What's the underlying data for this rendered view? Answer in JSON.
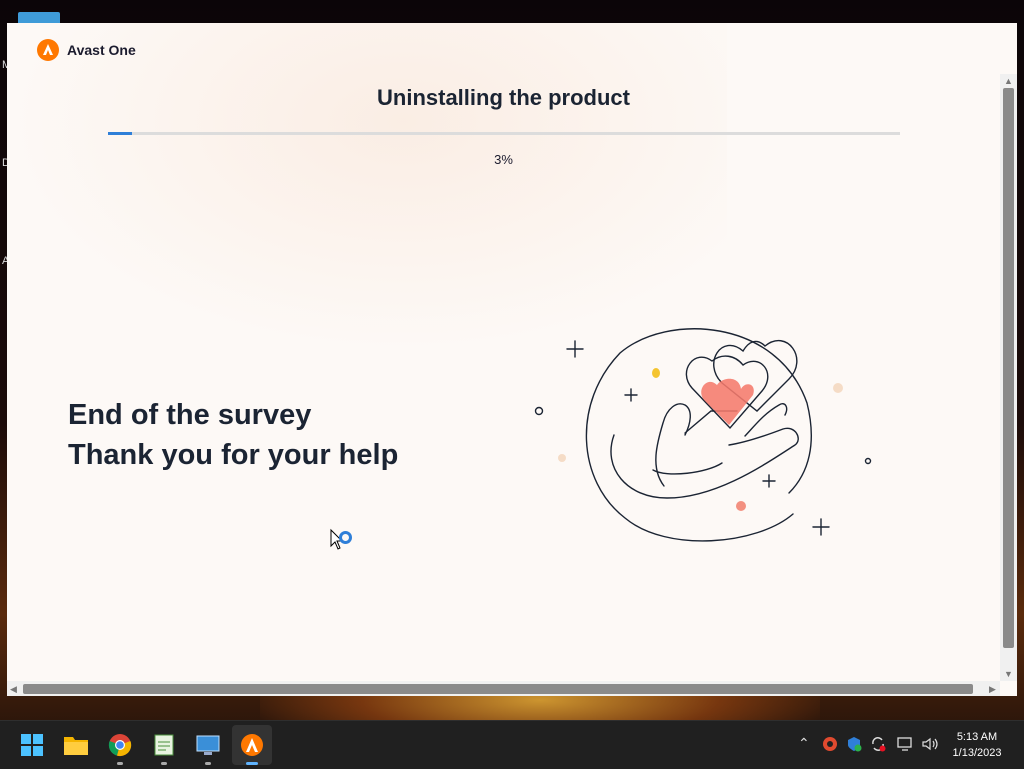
{
  "app": {
    "name": "Avast One",
    "brand_color": "#ff7800"
  },
  "page": {
    "title": "Uninstalling the product"
  },
  "progress": {
    "value": 0.03,
    "label": "3%",
    "bar_color": "#2f7fd8"
  },
  "survey": {
    "line1": "End of the survey",
    "line2": "Thank you for your help"
  },
  "desktop": {
    "icon_labels": [
      "M",
      "D",
      "A"
    ]
  },
  "taskbar": {
    "apps": [
      "start-icon",
      "file-explorer-icon",
      "chrome-icon",
      "notepad-icon",
      "control-panel-icon",
      "avast-one-icon"
    ],
    "tray_icons": [
      "chevron-up-icon",
      "ccleaner-icon",
      "security-icon",
      "update-icon",
      "network-icon",
      "volume-icon"
    ]
  },
  "clock": {
    "time": "5:13 AM",
    "date": "1/13/2023"
  }
}
